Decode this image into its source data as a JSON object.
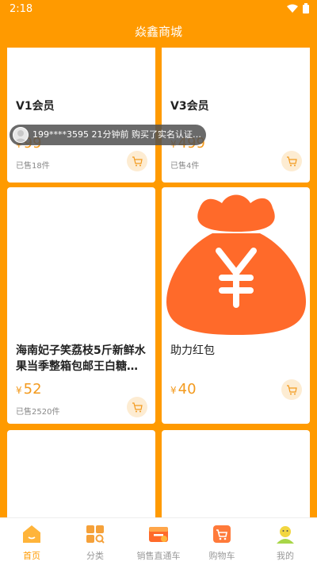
{
  "status": {
    "time": "2:18"
  },
  "app": {
    "title": "焱鑫商城"
  },
  "products": [
    {
      "name": "V1会员",
      "yen": "¥",
      "price": "99",
      "sold": "已售18件"
    },
    {
      "name": "V3会员",
      "yen": "¥",
      "price": "499",
      "sold": "已售4件"
    },
    {
      "name": "海南妃子笑荔枝5斤新鲜水果当季整箱包邮王白糖…",
      "yen": "¥",
      "price": "52",
      "sold": "已售2520件"
    },
    {
      "name": "助力红包",
      "yen": "¥",
      "price": "40",
      "sold": ""
    }
  ],
  "toast": {
    "text": "199****3595 21分钟前 购买了实名认证…"
  },
  "tabs": [
    {
      "label": "首页",
      "icon": "home-icon",
      "active": true
    },
    {
      "label": "分类",
      "icon": "category-icon"
    },
    {
      "label": "销售直通车",
      "icon": "sales-express-icon"
    },
    {
      "label": "购物车",
      "icon": "cart-icon"
    },
    {
      "label": "我的",
      "icon": "profile-icon"
    }
  ],
  "colors": {
    "brand": "#ff9a00",
    "price": "#f39a1e",
    "redpacket": "#ff6a2a"
  }
}
